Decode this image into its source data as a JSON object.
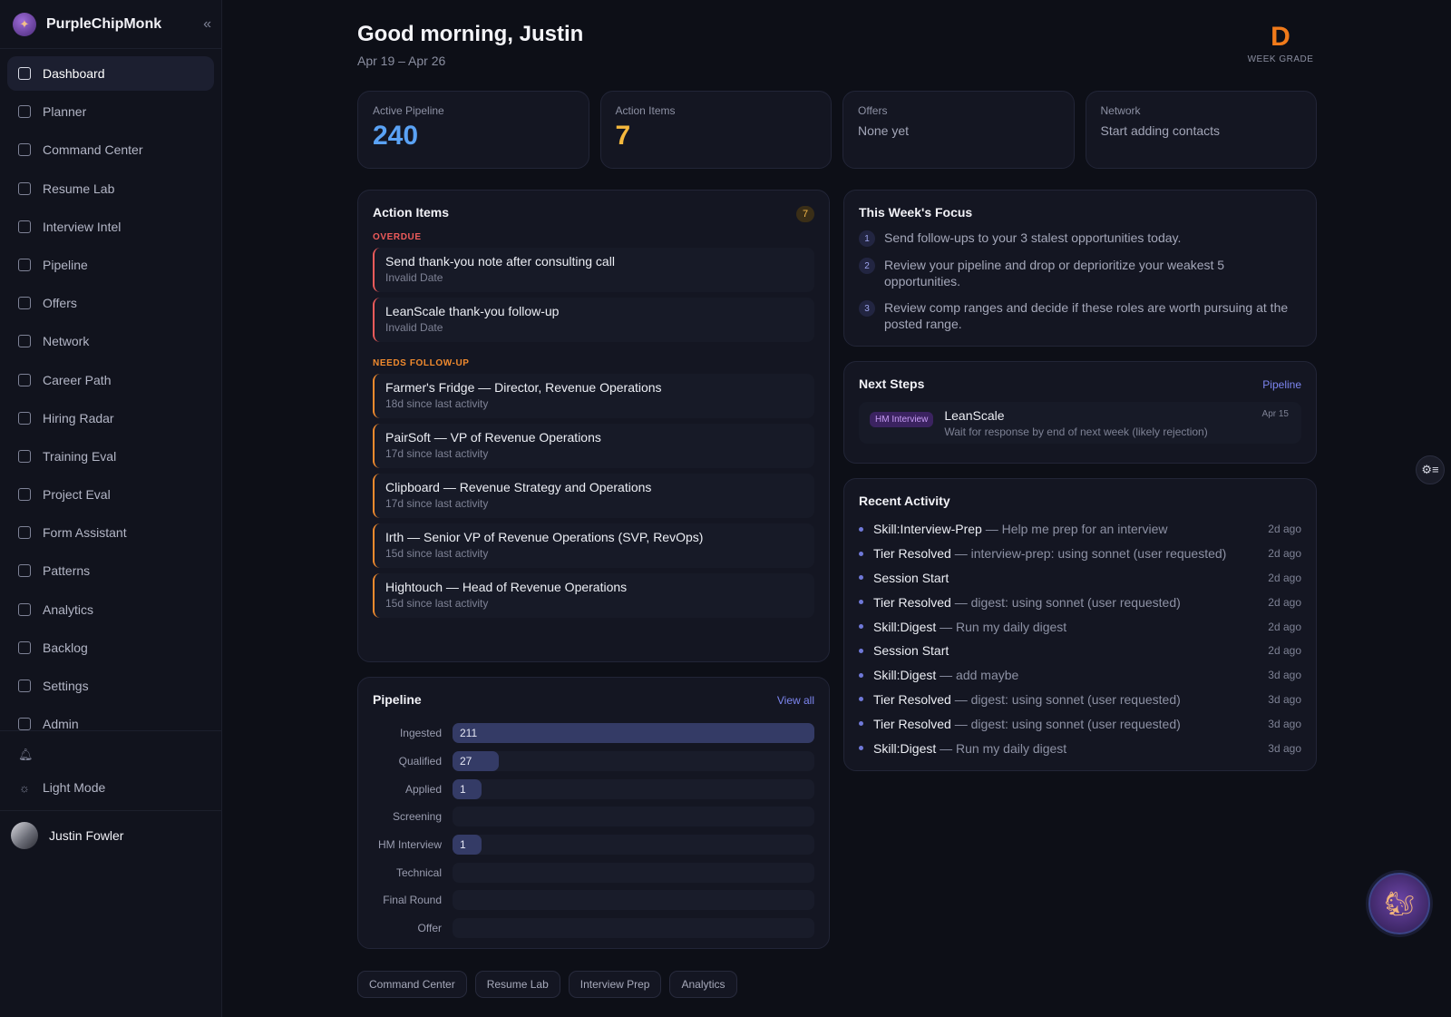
{
  "brand": {
    "name": "PurpleChipMonk",
    "collapse": "«"
  },
  "nav": [
    {
      "label": "Dashboard",
      "name": "dashboard",
      "active": true
    },
    {
      "label": "Planner",
      "name": "planner"
    },
    {
      "label": "Command Center",
      "name": "command-center"
    },
    {
      "label": "Resume Lab",
      "name": "resume-lab"
    },
    {
      "label": "Interview Intel",
      "name": "interview-intel"
    },
    {
      "label": "Pipeline",
      "name": "pipeline"
    },
    {
      "label": "Offers",
      "name": "offers"
    },
    {
      "label": "Network",
      "name": "network"
    },
    {
      "label": "Career Path",
      "name": "career-path"
    },
    {
      "label": "Hiring Radar",
      "name": "hiring-radar"
    },
    {
      "label": "Training Eval",
      "name": "training-eval"
    },
    {
      "label": "Project Eval",
      "name": "project-eval"
    },
    {
      "label": "Form Assistant",
      "name": "form-assistant"
    },
    {
      "label": "Patterns",
      "name": "patterns"
    },
    {
      "label": "Analytics",
      "name": "analytics"
    },
    {
      "label": "Backlog",
      "name": "backlog"
    },
    {
      "label": "Settings",
      "name": "settings"
    },
    {
      "label": "Admin",
      "name": "admin"
    }
  ],
  "tools": {
    "theme_label": "Light Mode"
  },
  "user": {
    "name": "Justin Fowler"
  },
  "header": {
    "greeting": "Good morning, Justin",
    "range": "Apr 19 – Apr 26"
  },
  "grade": {
    "letter": "D",
    "label": "WEEK GRADE"
  },
  "kpis": {
    "pipeline": {
      "label": "Active Pipeline",
      "value": "240",
      "color": "#5aa2f5"
    },
    "action": {
      "label": "Action Items",
      "value": "7",
      "color": "#f5b83d"
    },
    "offers": {
      "label": "Offers",
      "value": "None yet"
    },
    "network": {
      "label": "Network",
      "value": "Start adding contacts"
    }
  },
  "action_items": {
    "title": "Action Items",
    "count": "7",
    "overdue_label": "OVERDUE",
    "overdue_color": "#ee5b5b",
    "overdue": [
      {
        "title": "Send thank-you note after consulting call",
        "sub": "Invalid Date"
      },
      {
        "title": "LeanScale thank-you follow-up",
        "sub": "Invalid Date"
      }
    ],
    "followup_label": "NEEDS FOLLOW-UP",
    "followup_color": "#f08a2e",
    "followup": [
      {
        "title": "Farmer's Fridge — Director, Revenue Operations",
        "sub": "18d since last activity"
      },
      {
        "title": "PairSoft — VP of Revenue Operations",
        "sub": "17d since last activity"
      },
      {
        "title": "Clipboard — Revenue Strategy and Operations",
        "sub": "17d since last activity"
      },
      {
        "title": "Irth — Senior VP of Revenue Operations (SVP, RevOps)",
        "sub": "15d since last activity"
      },
      {
        "title": "Hightouch — Head of Revenue Operations",
        "sub": "15d since last activity"
      }
    ]
  },
  "pipeline": {
    "title": "Pipeline",
    "view_all": "View all",
    "stages": [
      {
        "label": "Ingested",
        "value": 211
      },
      {
        "label": "Qualified",
        "value": 27
      },
      {
        "label": "Applied",
        "value": 1
      },
      {
        "label": "Screening",
        "value": 0
      },
      {
        "label": "HM Interview",
        "value": 1
      },
      {
        "label": "Technical",
        "value": 0
      },
      {
        "label": "Final Round",
        "value": 0
      },
      {
        "label": "Offer",
        "value": 0
      }
    ]
  },
  "quick_links": [
    "Command Center",
    "Resume Lab",
    "Interview Prep",
    "Analytics"
  ],
  "focus": {
    "title": "This Week's Focus",
    "items": [
      {
        "num": "1",
        "text": "Send follow-ups to your 3 stalest opportunities today."
      },
      {
        "num": "2",
        "text": "Review your pipeline and drop or deprioritize your weakest 5 opportunities."
      },
      {
        "num": "3",
        "text": "Review comp ranges and decide if these roles are worth pursuing at the posted range."
      }
    ]
  },
  "next_steps": {
    "title": "Next Steps",
    "link": "Pipeline",
    "item": {
      "badge": "HM Interview",
      "company": "LeanScale",
      "sub": "Wait for response by end of next week (likely rejection)",
      "date": "Apr 15"
    }
  },
  "recent_activity": {
    "title": "Recent Activity",
    "items": [
      {
        "event": "Skill:Interview-Prep",
        "detail": " — Help me prep for an interview",
        "time": "2d ago"
      },
      {
        "event": "Tier Resolved",
        "detail": " — interview-prep: using sonnet (user requested)",
        "time": "2d ago"
      },
      {
        "event": "Session Start",
        "detail": "",
        "time": "2d ago"
      },
      {
        "event": "Tier Resolved",
        "detail": " — digest: using sonnet (user requested)",
        "time": "2d ago"
      },
      {
        "event": "Skill:Digest",
        "detail": " — Run my daily digest",
        "time": "2d ago"
      },
      {
        "event": "Session Start",
        "detail": "",
        "time": "2d ago"
      },
      {
        "event": "Skill:Digest",
        "detail": " — add maybe",
        "time": "3d ago"
      },
      {
        "event": "Tier Resolved",
        "detail": " — digest: using sonnet (user requested)",
        "time": "3d ago"
      },
      {
        "event": "Tier Resolved",
        "detail": " — digest: using sonnet (user requested)",
        "time": "3d ago"
      },
      {
        "event": "Skill:Digest",
        "detail": " — Run my daily digest",
        "time": "3d ago"
      }
    ]
  }
}
